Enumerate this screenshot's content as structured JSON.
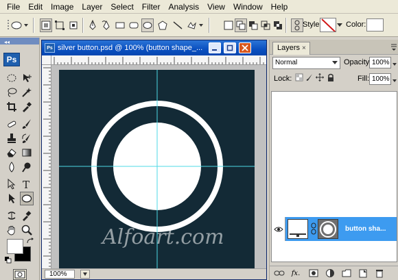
{
  "menu": [
    "File",
    "Edit",
    "Image",
    "Layer",
    "Select",
    "Filter",
    "Analysis",
    "View",
    "Window",
    "Help"
  ],
  "options_bar": {
    "style_label": "Style:",
    "color_label": "Color:",
    "color_value": "#ffffff"
  },
  "tools": {
    "app_logo": "Ps",
    "foreground_color": "#ffffff",
    "background_color": "#000000",
    "selected_tool": "ellipse-tool"
  },
  "document": {
    "title": "silver button.psd @ 100% (button shape_...",
    "zoom": "100%",
    "canvas_color": "#132a36",
    "guide_color": "#4dd9e6",
    "watermark": "Alfoart.com"
  },
  "layers_panel": {
    "tab_label": "Layers",
    "blend_mode": "Normal",
    "opacity_label": "Opacity:",
    "opacity_value": "100%",
    "lock_label": "Lock:",
    "fill_label": "Fill:",
    "fill_value": "100%",
    "layer_name": "button sha...",
    "selected_color": "#3d9bf0"
  },
  "colors": {
    "title_bar": "#0a4fc0",
    "chrome": "#d4d0c8",
    "menubar": "#ece9d8"
  }
}
